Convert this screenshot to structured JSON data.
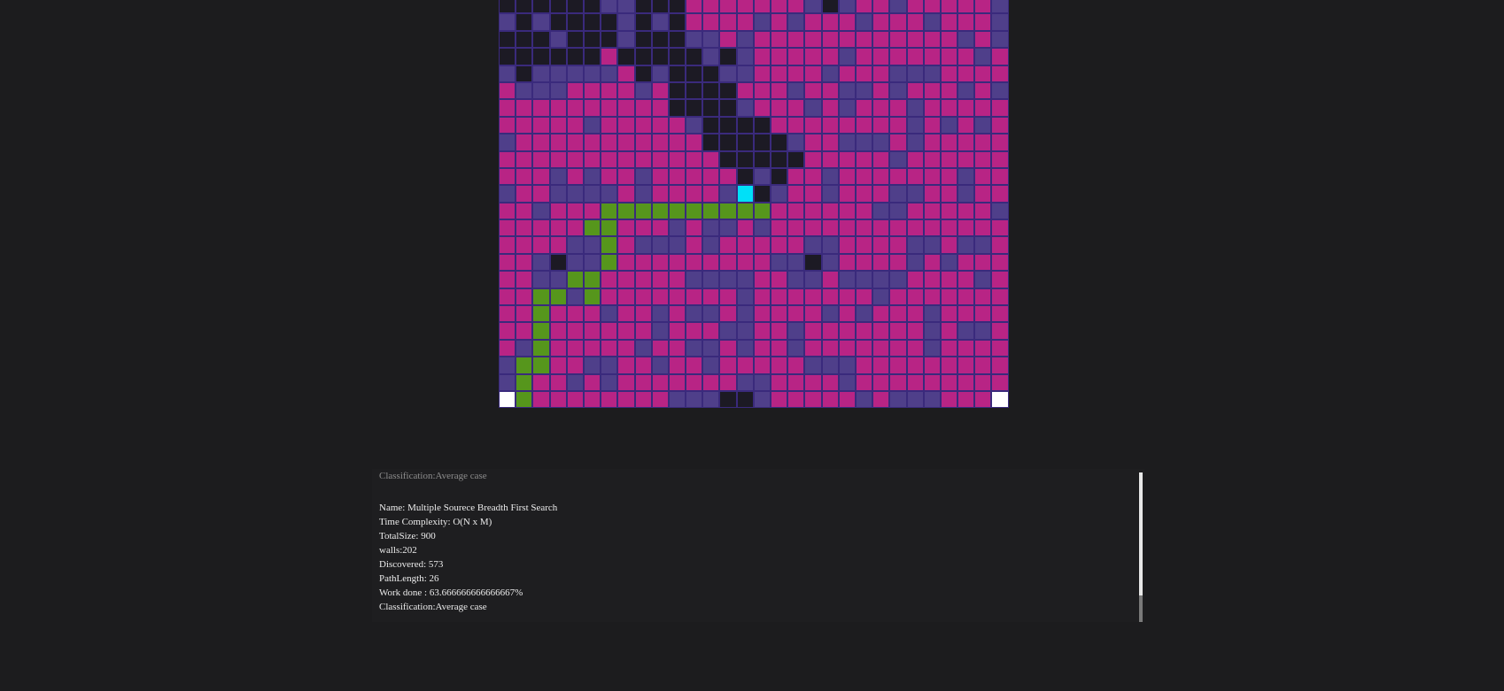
{
  "visualizer": {
    "grid_rows": [
      "wwwwwwppwwwmmmmmmmpwpmmpmmmmmp",
      "pwpwwwwpwpwmmmmpmpmmmpmmmpmmmp",
      "wwwpwwwpwwwppmpmmmmmmmmmmmmpmp",
      "wwwwwwmwwwwwpwpmmmmmpmmmmmmmpm",
      "pwpppppmwpwwwppmmmmpmmmpppmmmm",
      "mpppmmmmpmwwwwmmmpmmppmpmmmpmp",
      "mmmmmmmmmmwwwwpmmmpmpmmmpmmmmm",
      "mmmmmpmmmmmpwwwwmmmmmmmmpmpmpm",
      "pmmmmmmmmmmmwwwwwpmmpppmpmmmmm",
      "mmmmmmmmmmmmmwwwwwmmmmmpmmmmmm",
      "mmmpmpmmpmmmmmwpwmmpmmmmmmmpmm",
      "pmmppppmpmmmmpcwpmmpmmmppmmpmm",
      "mmpmmmggggggggggmmmmmmppmmmmmp",
      "mmmmmggmmmpmppmpmmmmmmmmmmmmmm",
      "mmmmppgmpppmpmmmmmppmmmmppmppm",
      "mmpwppgmmmmmmmmmppwpmmmmpmpmmm",
      "mmppggmmmmmppppmmppmppppmmmmpm",
      "mmggpgmmmmmmmmpmmmmmmmpmmmmmmm",
      "mmgmmmpmmpmppmpmmmmpmpmmmpmmmm",
      "mmgmmmmmmpmmmppmmpmmmmmmmpmppm",
      "mpgmmmmmpmmppmpmmpmmmmmmmpmmmm",
      "pggmmppmmpmmpmmmmmpppmmmmmmmmm",
      "pgmmpmpmmmmmmmppmmmmpmmmmmmmmm",
      "sgmmmmmmmmpppwwpmmmmmpmpppmmms"
    ],
    "cell_types": {
      "w": "wall",
      "p": "discovered",
      "m": "frontier",
      "g": "path",
      "c": "current",
      "s": "source"
    },
    "colors": {
      "background": "#1c1c1e",
      "frontier": "#b82485",
      "discovered": "#4f3f8a",
      "wall": "#1c1a24",
      "path": "#56961c",
      "current": "#00e0f8",
      "source": "#ffffff",
      "cell_border": "#3a2a7c"
    }
  },
  "log": {
    "previous_classification": "Classification:Average case",
    "lines": [
      "Name: Multiple Sourece Breadth First Search",
      "Time Complexity: O(N x M)",
      "TotalSize: 900",
      "walls:202",
      "Discovered: 573",
      "PathLength: 26",
      "Work done : 63.666666666666667%",
      "Classification:Average case"
    ],
    "scroll_position": 0.97
  }
}
